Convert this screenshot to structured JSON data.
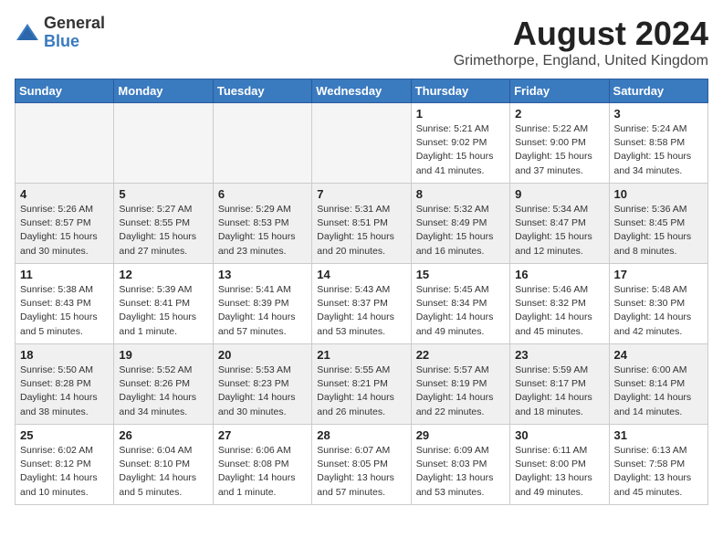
{
  "logo": {
    "general": "General",
    "blue": "Blue"
  },
  "title": {
    "month_year": "August 2024",
    "location": "Grimethorpe, England, United Kingdom"
  },
  "days_of_week": [
    "Sunday",
    "Monday",
    "Tuesday",
    "Wednesday",
    "Thursday",
    "Friday",
    "Saturday"
  ],
  "weeks": [
    [
      {
        "day": "",
        "info": "",
        "empty": true
      },
      {
        "day": "",
        "info": "",
        "empty": true
      },
      {
        "day": "",
        "info": "",
        "empty": true
      },
      {
        "day": "",
        "info": "",
        "empty": true
      },
      {
        "day": "1",
        "info": "Sunrise: 5:21 AM\nSunset: 9:02 PM\nDaylight: 15 hours\nand 41 minutes.",
        "empty": false
      },
      {
        "day": "2",
        "info": "Sunrise: 5:22 AM\nSunset: 9:00 PM\nDaylight: 15 hours\nand 37 minutes.",
        "empty": false
      },
      {
        "day": "3",
        "info": "Sunrise: 5:24 AM\nSunset: 8:58 PM\nDaylight: 15 hours\nand 34 minutes.",
        "empty": false
      }
    ],
    [
      {
        "day": "4",
        "info": "Sunrise: 5:26 AM\nSunset: 8:57 PM\nDaylight: 15 hours\nand 30 minutes.",
        "empty": false
      },
      {
        "day": "5",
        "info": "Sunrise: 5:27 AM\nSunset: 8:55 PM\nDaylight: 15 hours\nand 27 minutes.",
        "empty": false
      },
      {
        "day": "6",
        "info": "Sunrise: 5:29 AM\nSunset: 8:53 PM\nDaylight: 15 hours\nand 23 minutes.",
        "empty": false
      },
      {
        "day": "7",
        "info": "Sunrise: 5:31 AM\nSunset: 8:51 PM\nDaylight: 15 hours\nand 20 minutes.",
        "empty": false
      },
      {
        "day": "8",
        "info": "Sunrise: 5:32 AM\nSunset: 8:49 PM\nDaylight: 15 hours\nand 16 minutes.",
        "empty": false
      },
      {
        "day": "9",
        "info": "Sunrise: 5:34 AM\nSunset: 8:47 PM\nDaylight: 15 hours\nand 12 minutes.",
        "empty": false
      },
      {
        "day": "10",
        "info": "Sunrise: 5:36 AM\nSunset: 8:45 PM\nDaylight: 15 hours\nand 8 minutes.",
        "empty": false
      }
    ],
    [
      {
        "day": "11",
        "info": "Sunrise: 5:38 AM\nSunset: 8:43 PM\nDaylight: 15 hours\nand 5 minutes.",
        "empty": false
      },
      {
        "day": "12",
        "info": "Sunrise: 5:39 AM\nSunset: 8:41 PM\nDaylight: 15 hours\nand 1 minute.",
        "empty": false
      },
      {
        "day": "13",
        "info": "Sunrise: 5:41 AM\nSunset: 8:39 PM\nDaylight: 14 hours\nand 57 minutes.",
        "empty": false
      },
      {
        "day": "14",
        "info": "Sunrise: 5:43 AM\nSunset: 8:37 PM\nDaylight: 14 hours\nand 53 minutes.",
        "empty": false
      },
      {
        "day": "15",
        "info": "Sunrise: 5:45 AM\nSunset: 8:34 PM\nDaylight: 14 hours\nand 49 minutes.",
        "empty": false
      },
      {
        "day": "16",
        "info": "Sunrise: 5:46 AM\nSunset: 8:32 PM\nDaylight: 14 hours\nand 45 minutes.",
        "empty": false
      },
      {
        "day": "17",
        "info": "Sunrise: 5:48 AM\nSunset: 8:30 PM\nDaylight: 14 hours\nand 42 minutes.",
        "empty": false
      }
    ],
    [
      {
        "day": "18",
        "info": "Sunrise: 5:50 AM\nSunset: 8:28 PM\nDaylight: 14 hours\nand 38 minutes.",
        "empty": false
      },
      {
        "day": "19",
        "info": "Sunrise: 5:52 AM\nSunset: 8:26 PM\nDaylight: 14 hours\nand 34 minutes.",
        "empty": false
      },
      {
        "day": "20",
        "info": "Sunrise: 5:53 AM\nSunset: 8:23 PM\nDaylight: 14 hours\nand 30 minutes.",
        "empty": false
      },
      {
        "day": "21",
        "info": "Sunrise: 5:55 AM\nSunset: 8:21 PM\nDaylight: 14 hours\nand 26 minutes.",
        "empty": false
      },
      {
        "day": "22",
        "info": "Sunrise: 5:57 AM\nSunset: 8:19 PM\nDaylight: 14 hours\nand 22 minutes.",
        "empty": false
      },
      {
        "day": "23",
        "info": "Sunrise: 5:59 AM\nSunset: 8:17 PM\nDaylight: 14 hours\nand 18 minutes.",
        "empty": false
      },
      {
        "day": "24",
        "info": "Sunrise: 6:00 AM\nSunset: 8:14 PM\nDaylight: 14 hours\nand 14 minutes.",
        "empty": false
      }
    ],
    [
      {
        "day": "25",
        "info": "Sunrise: 6:02 AM\nSunset: 8:12 PM\nDaylight: 14 hours\nand 10 minutes.",
        "empty": false
      },
      {
        "day": "26",
        "info": "Sunrise: 6:04 AM\nSunset: 8:10 PM\nDaylight: 14 hours\nand 5 minutes.",
        "empty": false
      },
      {
        "day": "27",
        "info": "Sunrise: 6:06 AM\nSunset: 8:08 PM\nDaylight: 14 hours\nand 1 minute.",
        "empty": false
      },
      {
        "day": "28",
        "info": "Sunrise: 6:07 AM\nSunset: 8:05 PM\nDaylight: 13 hours\nand 57 minutes.",
        "empty": false
      },
      {
        "day": "29",
        "info": "Sunrise: 6:09 AM\nSunset: 8:03 PM\nDaylight: 13 hours\nand 53 minutes.",
        "empty": false
      },
      {
        "day": "30",
        "info": "Sunrise: 6:11 AM\nSunset: 8:00 PM\nDaylight: 13 hours\nand 49 minutes.",
        "empty": false
      },
      {
        "day": "31",
        "info": "Sunrise: 6:13 AM\nSunset: 7:58 PM\nDaylight: 13 hours\nand 45 minutes.",
        "empty": false
      }
    ]
  ]
}
